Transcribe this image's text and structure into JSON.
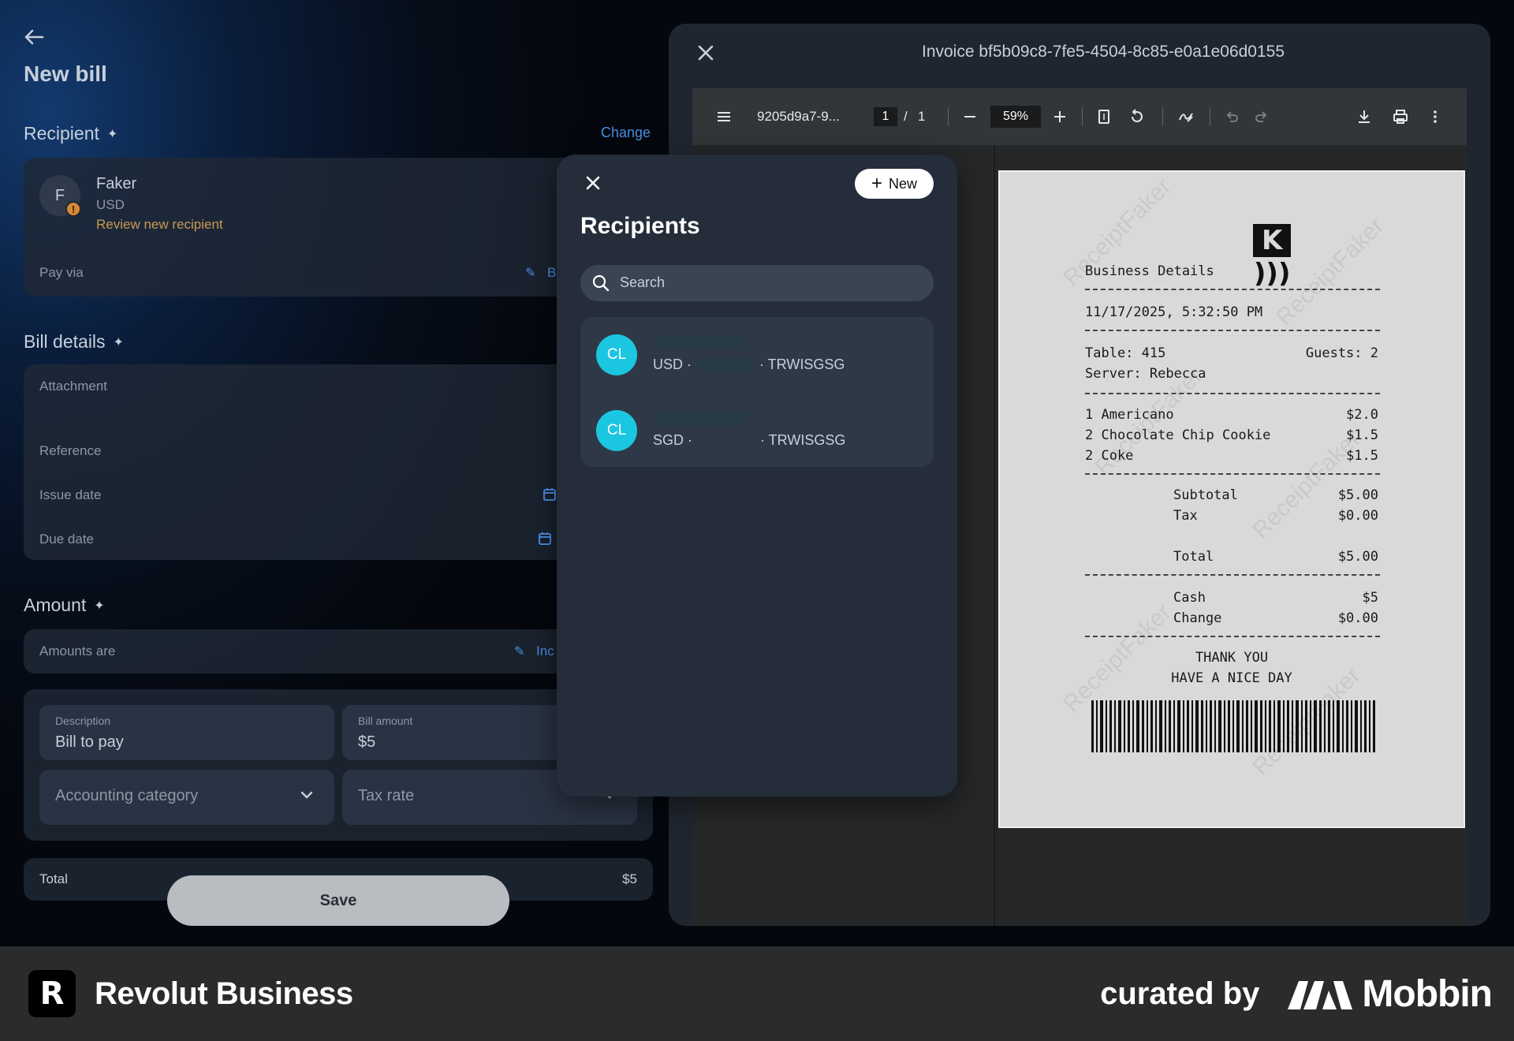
{
  "app": {
    "title": "New bill"
  },
  "recipient": {
    "section_label": "Recipient",
    "change_label": "Change",
    "avatar_initial": "F",
    "warning_glyph": "!",
    "name": "Faker",
    "currency": "USD",
    "review_label": "Review new recipient",
    "pay_via_label": "Pay via",
    "pay_via_value_trunc": "B"
  },
  "bill_details": {
    "section_label": "Bill details",
    "attachment_label": "Attachment",
    "reference_label": "Reference",
    "issue_date_label": "Issue date",
    "due_date_label": "Due date"
  },
  "amount": {
    "section_label": "Amount",
    "amounts_are_label": "Amounts are",
    "amounts_are_value_trunc": "Inc",
    "description_label": "Description",
    "description_value": "Bill to pay",
    "bill_amount_label": "Bill amount",
    "bill_amount_value": "$5",
    "accounting_placeholder": "Accounting category",
    "tax_placeholder": "Tax rate",
    "total_label": "Total",
    "total_value": "$5",
    "save_label": "Save"
  },
  "viewer": {
    "title": "Invoice bf5b09c8-7fe5-4504-8c85-e0a1e06d0155",
    "file_name": "9205d9a7-9...",
    "page_current": "1",
    "page_sep": "/",
    "page_total": "1",
    "zoom": "59%"
  },
  "receipt": {
    "logo_text": "K",
    "business_details": "Business Details",
    "datetime": "11/17/2025, 5:32:50 PM",
    "table": "Table: 415",
    "guests": "Guests: 2",
    "server": "Server: Rebecca",
    "items": [
      {
        "label": "1 Americano",
        "price": "$2.0"
      },
      {
        "label": "2 Chocolate Chip Cookie",
        "price": "$1.5"
      },
      {
        "label": "2 Coke",
        "price": "$1.5"
      }
    ],
    "subtotal_label": "Subtotal",
    "subtotal_value": "$5.00",
    "tax_label": "Tax",
    "tax_value": "$0.00",
    "total_label": "Total",
    "total_value": "$5.00",
    "cash_label": "Cash",
    "cash_value": "$5",
    "change_label": "Change",
    "change_value": "$0.00",
    "thanks_1": "THANK YOU",
    "thanks_2": "HAVE A NICE DAY",
    "watermark": "ReceiptFaker"
  },
  "recipients_modal": {
    "title": "Recipients",
    "new_label": "New",
    "search_placeholder": "Search",
    "items": [
      {
        "initials": "CL",
        "currency": "USD ·",
        "swift": "· TRWISGSG"
      },
      {
        "initials": "CL",
        "currency": "SGD ·",
        "swift": "· TRWISGSG"
      }
    ]
  },
  "footer": {
    "brand_logo": "R",
    "brand_name": "Revolut Business",
    "curated_by": "curated by",
    "mobbin": "Mobbin"
  },
  "colors": {
    "accent_blue": "#4a8fe6",
    "warning": "#d8892f",
    "avatar_cyan": "#1bc7e0"
  }
}
